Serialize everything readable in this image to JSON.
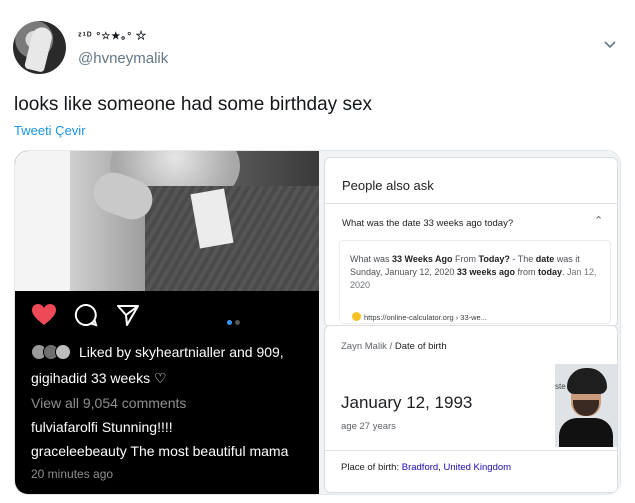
{
  "tweet": {
    "display_name": "ᶻ¹ᴰ °☆★｡° ☆",
    "handle": "@hvneymalik",
    "text": "looks like someone had some birthday sex",
    "translate_label": "Tweeti Çevir"
  },
  "instagram": {
    "liked_by_prefix": "Liked by",
    "liked_by_user": "skyheartnialler",
    "liked_by_suffix": "and 909,",
    "author": "gigihadid",
    "caption": "33 weeks ♡",
    "view_comments": "View all 9,054 comments",
    "comments": [
      {
        "user": "fulviafarolfi",
        "text": "Stunning!!!!"
      },
      {
        "user": "graceleebeauty",
        "text": "The most beautiful mama"
      }
    ],
    "timestamp": "20 minutes ago",
    "colors": {
      "heart": "#ed4956",
      "dot_active": "#3897f0",
      "dot_inactive": "#555555"
    }
  },
  "google": {
    "paa_title": "People also ask",
    "question": "What was the date 33 weeks ago today?",
    "answer": {
      "p1": "What was ",
      "b1": "33 Weeks Ago",
      "p2": " From ",
      "b2": "Today?",
      "p3": " - The ",
      "b3": "date",
      "p4": " was it Sunday, January 12, 2020 ",
      "b4": "33 weeks ago",
      "p5": " from ",
      "b5": "today",
      "p6": ". ",
      "date": "Jan 12, 2020"
    },
    "source": "https://online-calculator.org › 33-we...",
    "kg": {
      "crumb_person": "Zayn Malik",
      "crumb_sep": " / ",
      "crumb_field": "Date of birth",
      "date": "January 12, 1993",
      "age": "age 27 years",
      "photo_text": "ste",
      "birth_label": "Place of birth: ",
      "birth_city": "Bradford",
      "birth_sep": ", ",
      "birth_country": "United Kingdom"
    }
  }
}
